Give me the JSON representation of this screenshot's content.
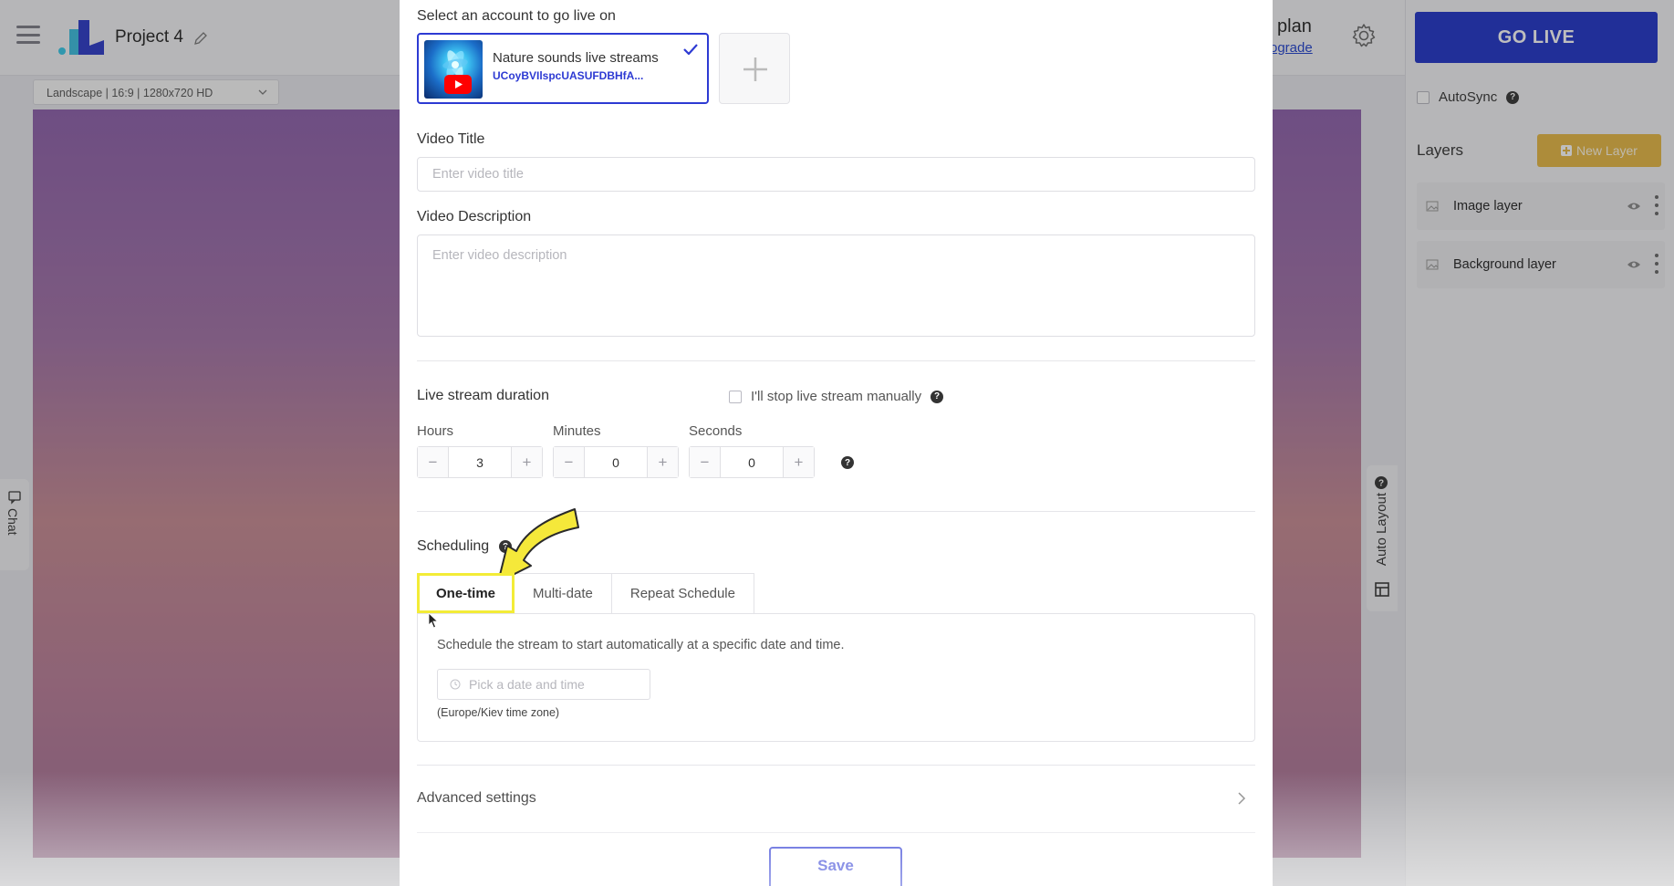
{
  "header": {
    "project_title": "Project 4",
    "plan_label": "plan",
    "upgrade_label": "ograde"
  },
  "canvas": {
    "resolution": "Landscape | 16:9 | 1280x720 HD"
  },
  "side_tabs": {
    "chat": "Chat",
    "auto_layout": "Auto Layout"
  },
  "right_panel": {
    "go_live": "GO LIVE",
    "autosync": "AutoSync",
    "layers_title": "Layers",
    "new_layer": "New Layer",
    "layers": [
      {
        "name": "Image layer"
      },
      {
        "name": "Background layer"
      }
    ]
  },
  "modal": {
    "account_heading": "Select an account to go live on",
    "account": {
      "name": "Nature sounds live streams",
      "channel_id": "UCoyBVIlspcUASUFDBHfA..."
    },
    "video_title_label": "Video Title",
    "video_title_placeholder": "Enter video title",
    "video_description_label": "Video Description",
    "video_description_placeholder": "Enter video description",
    "duration_heading": "Live stream duration",
    "manual_stop_label": "I'll stop live stream manually",
    "hours_label": "Hours",
    "minutes_label": "Minutes",
    "seconds_label": "Seconds",
    "hours_value": "3",
    "minutes_value": "0",
    "seconds_value": "0",
    "scheduling_heading": "Scheduling",
    "tabs": [
      {
        "label": "One-time",
        "active": true
      },
      {
        "label": "Multi-date",
        "active": false
      },
      {
        "label": "Repeat Schedule",
        "active": false
      }
    ],
    "schedule_description": "Schedule the stream to start automatically at a specific date and time.",
    "date_placeholder": "Pick a date and time",
    "timezone_note": "(Europe/Kiev time zone)",
    "advanced_settings": "Advanced settings",
    "save": "Save"
  },
  "colors": {
    "accent": "#2d3ad3",
    "go_live": "#1f33c9",
    "new_layer": "#e7b843",
    "highlight": "#f3ec37"
  }
}
